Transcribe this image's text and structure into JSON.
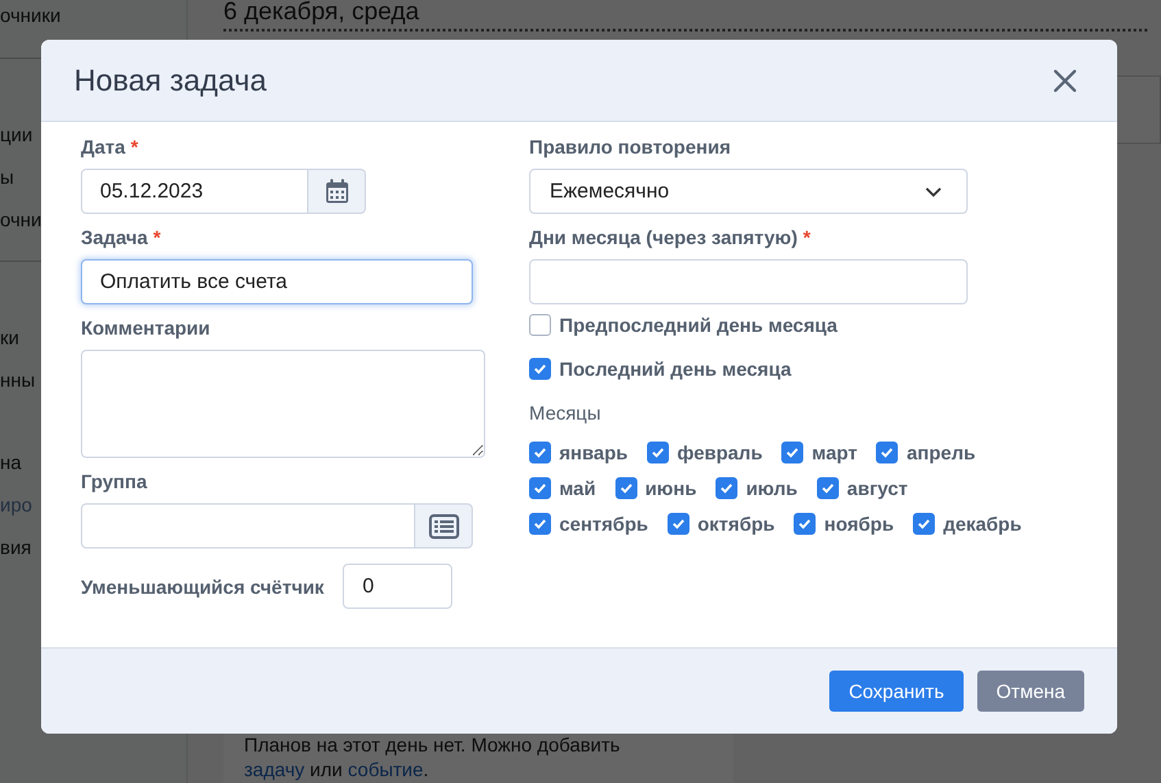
{
  "background": {
    "sidebar_groups": [
      {
        "items": [
          {
            "label": "очники",
            "disabled": false
          }
        ]
      },
      {
        "items": [
          {
            "label": "ции",
            "disabled": false
          },
          {
            "label": "ы",
            "disabled": false
          },
          {
            "label": "очни",
            "disabled": false
          }
        ]
      },
      {
        "items": [
          {
            "label": "ки",
            "disabled": false
          },
          {
            "label": "нны",
            "disabled": false
          },
          {
            "label": "на",
            "disabled": false
          },
          {
            "label": "иро",
            "disabled": true
          },
          {
            "label": "вия",
            "disabled": false
          }
        ]
      }
    ],
    "date_heading": "6 декабря, среда",
    "empty_message": {
      "before": "Планов на этот день нет. Можно добавить",
      "link_1": "задачу",
      "middle": "или",
      "link_2": "событие",
      "after": "."
    }
  },
  "dialog": {
    "title": "Новая задача",
    "date": {
      "label": "Дата",
      "required_mark": "*",
      "value": "05.12.2023"
    },
    "task": {
      "label": "Задача",
      "required_mark": "*",
      "value": "Оплатить все счета",
      "focused": true
    },
    "comments": {
      "label": "Комментарии"
    },
    "group": {
      "label": "Группа"
    },
    "counter": {
      "label": "Уменьшающийся счётчик",
      "value": "0"
    },
    "repeat_rule": {
      "label": "Правило повторения",
      "value": "Ежемесячно"
    },
    "month_days": {
      "label": "Дни месяца (через запятую)",
      "required_mark": "*"
    },
    "options": [
      {
        "label": "Предпоследний день месяца",
        "checked": false
      },
      {
        "label": "Последний день месяца",
        "checked": true
      }
    ],
    "months_label": "Месяцы",
    "months": [
      [
        {
          "label": "январь",
          "checked": true
        },
        {
          "label": "февраль",
          "checked": true
        },
        {
          "label": "март",
          "checked": true
        },
        {
          "label": "апрель",
          "checked": true
        }
      ],
      [
        {
          "label": "май",
          "checked": true
        },
        {
          "label": "июнь",
          "checked": true
        },
        {
          "label": "июль",
          "checked": true
        },
        {
          "label": "август",
          "checked": true
        }
      ],
      [
        {
          "label": "сентябрь",
          "checked": true
        },
        {
          "label": "октябрь",
          "checked": true
        },
        {
          "label": "ноябрь",
          "checked": true
        },
        {
          "label": "декабрь",
          "checked": true
        }
      ]
    ],
    "buttons": [
      {
        "label": "Сохранить",
        "kind": "primary"
      },
      {
        "label": "Отмена",
        "kind": "secondary"
      }
    ]
  }
}
